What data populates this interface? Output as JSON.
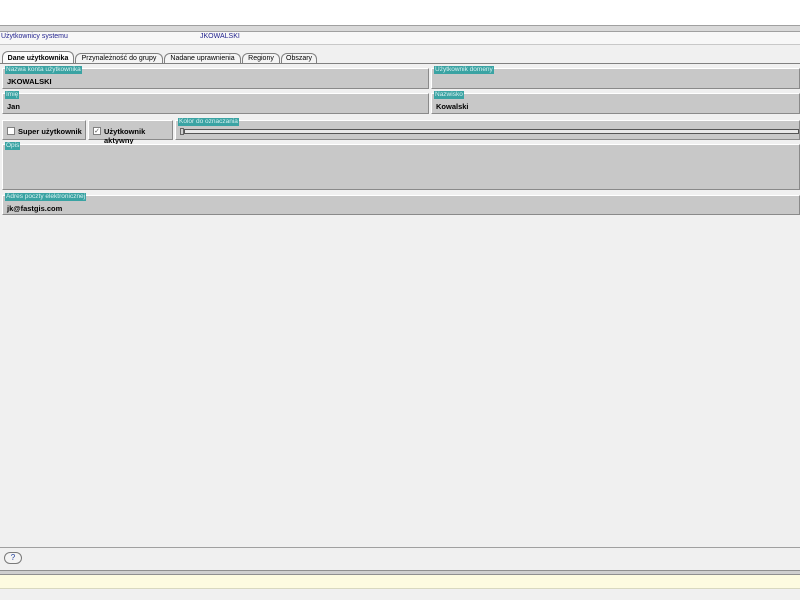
{
  "breadcrumb": {
    "section": "Użytkownicy systemu",
    "current": "JKOWALSKI"
  },
  "tabs": [
    {
      "label": "Dane użytkownika",
      "active": true
    },
    {
      "label": "Przynależność do grupy",
      "active": false
    },
    {
      "label": "Nadane uprawnienia",
      "active": false
    },
    {
      "label": "Regiony",
      "active": false
    },
    {
      "label": "Obszary",
      "active": false
    }
  ],
  "form": {
    "login_label": "Nazwa konta użytkownika",
    "login_value": "JKOWALSKI",
    "domain_label": "Użytkownik domeny",
    "domain_value": "",
    "first_name_label": "Imię",
    "first_name_value": "Jan",
    "last_name_label": "Nazwisko",
    "last_name_value": "Kowalski",
    "superuser_label": "Super użytkownik",
    "superuser_checked": false,
    "active_label": "Użytkownik aktywny",
    "active_checked": true,
    "color_label": "Kolor do oznaczania",
    "description_label": "Opis",
    "description_value": "",
    "email_label": "Adres poczty elektronicznej",
    "email_value": "jk@fastgis.com"
  },
  "footer": {
    "help_icon": "help-question-icon"
  }
}
